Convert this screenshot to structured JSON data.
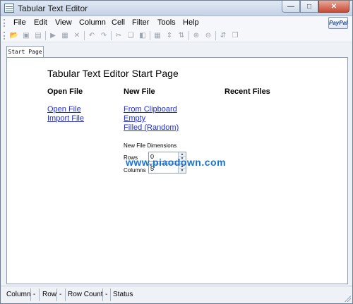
{
  "window": {
    "title": "Tabular Text Editor",
    "minimize_icon": "minimize-icon",
    "maximize_icon": "maximize-icon",
    "close_icon": "close-icon"
  },
  "menu": {
    "items": [
      "File",
      "Edit",
      "View",
      "Column",
      "Cell",
      "Filter",
      "Tools",
      "Help"
    ],
    "paypal_label": "PayPal"
  },
  "toolbar": {
    "icons": [
      "open-folder-icon",
      "save-icon",
      "document-icon",
      "insert-row-icon",
      "insert-column-icon",
      "delete-icon",
      "undo-icon",
      "redo-icon",
      "cut-icon",
      "copy-icon",
      "paste-icon",
      "table-icon",
      "sort-vertical-icon",
      "sort-compress-icon",
      "zoom-in-icon",
      "zoom-out-icon",
      "sort-az-icon",
      "document-copy-icon"
    ]
  },
  "tabs": [
    {
      "label": "Start Page"
    }
  ],
  "start_page": {
    "title": "Tabular Text Editor Start Page",
    "open_file": {
      "heading": "Open File",
      "links": [
        "Open File",
        "Import File"
      ]
    },
    "new_file": {
      "heading": "New File",
      "links": [
        "From Clipboard",
        "Empty",
        "Filled (Random)"
      ]
    },
    "recent_files": {
      "heading": "Recent Files"
    },
    "dimensions": {
      "label": "New File Dimensions",
      "rows_label": "Rows",
      "rows_value": "0",
      "columns_label": "Columns",
      "columns_value": "5"
    },
    "watermark": "www.piaodown.com"
  },
  "statusbar": {
    "column_label": "Column",
    "column_value": "-",
    "row_label": "Row",
    "row_value": "-",
    "row_count_label": "Row Count",
    "row_count_value": "-",
    "status_label": "Status"
  }
}
